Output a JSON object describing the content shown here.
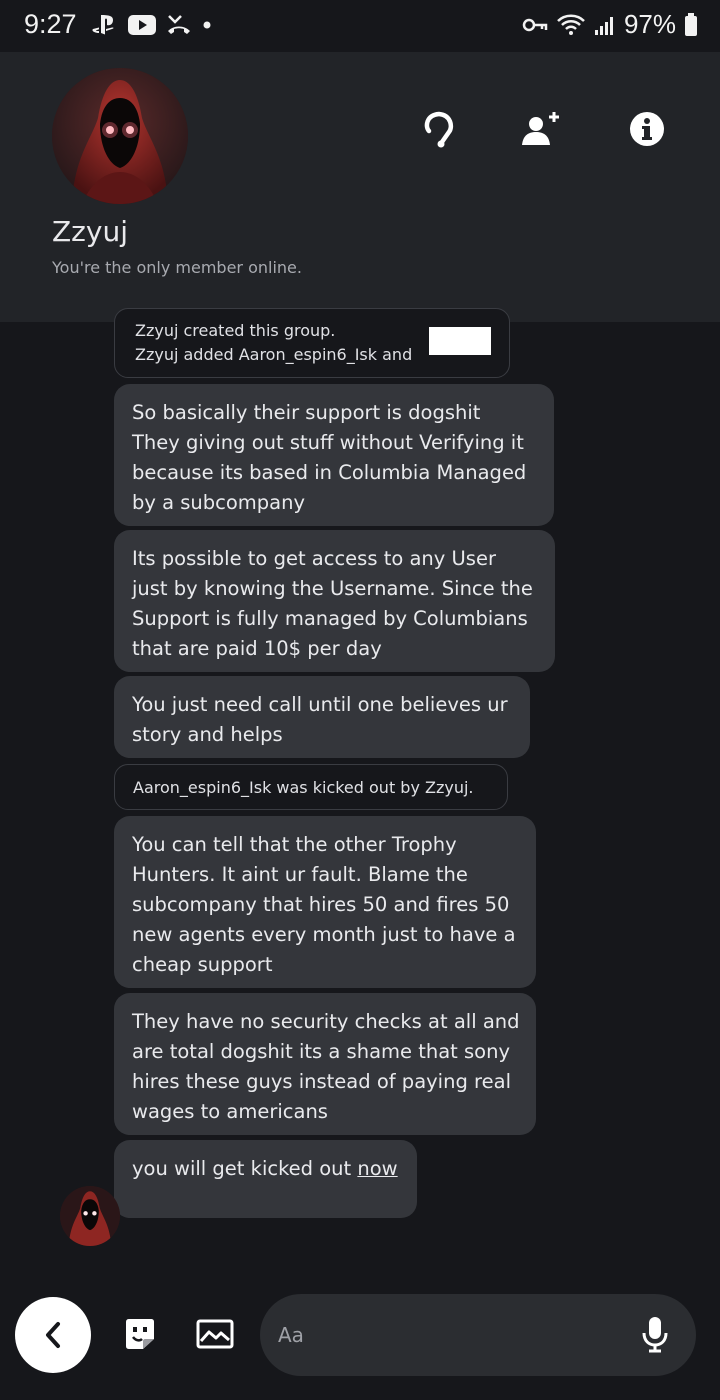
{
  "status_bar": {
    "time": "9:27",
    "battery": "97%"
  },
  "header": {
    "title": "Zzyuj",
    "subtitle": "You're the only member online."
  },
  "system_notes": {
    "group": [
      "Zzyuj created this group.",
      "Zzyuj added Aaron_espin6_Isk and"
    ],
    "kicked": "Aaron_espin6_Isk was kicked out by Zzyuj."
  },
  "messages": [
    {
      "lines": [
        "So basically their support is dogshit",
        "They giving out stuff without Verifying it",
        "because its based in Columbia Managed",
        "by a subcompany"
      ]
    },
    {
      "lines": [
        "Its possible to get access to any User",
        "just by knowing the Username. Since the",
        "Support is fully managed by Columbians",
        "that are paid 10$ per day"
      ]
    },
    {
      "lines": [
        "You just need call until one believes ur",
        "story and helps"
      ]
    },
    {
      "lines": [
        "You can tell that the other Trophy",
        "Hunters. It aint ur fault. Blame the",
        "subcompany that hires 50 and fires 50",
        "new agents every month just to have a",
        "cheap support"
      ]
    },
    {
      "lines": [
        "They have no security checks at all and",
        "are total dogshit its a shame that sony",
        "hires these guys instead of paying real",
        "wages to americans"
      ]
    },
    {
      "lines": [
        "you will get kicked out "
      ],
      "link_text": "now"
    }
  ],
  "composer": {
    "placeholder": "Aa"
  },
  "colors": {
    "background": "#16171b",
    "header_bg": "#222428",
    "bubble_bg": "#34363b",
    "input_bg": "#2b2d31"
  },
  "icons": [
    "playstation-icon",
    "youtube-icon",
    "missed-call-icon",
    "key-icon",
    "wifi-icon",
    "signal-icon",
    "battery-icon",
    "headset-icon",
    "add-member-icon",
    "info-icon",
    "back-icon",
    "sticker-icon",
    "image-icon",
    "mic-icon"
  ]
}
